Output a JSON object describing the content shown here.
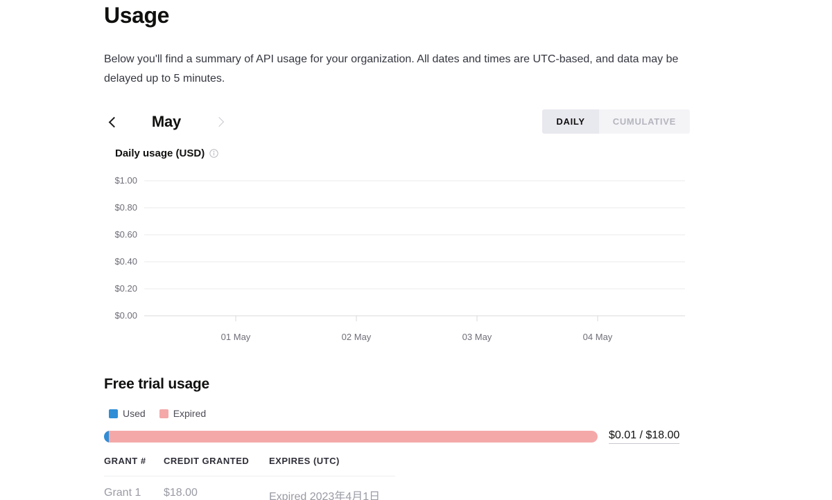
{
  "header": {
    "title": "Usage",
    "description": "Below you'll find a summary of API usage for your organization. All dates and times are UTC-based, and data may be delayed up to 5 minutes."
  },
  "controls": {
    "prev_icon": "chevron-left-icon",
    "next_icon": "chevron-right-icon",
    "month": "May",
    "segments": [
      {
        "label": "DAILY",
        "active": true
      },
      {
        "label": "CUMULATIVE",
        "active": false
      }
    ]
  },
  "chart_section": {
    "title": "Daily usage (USD)",
    "info_icon": "info-circle-icon"
  },
  "chart_data": {
    "type": "bar",
    "title": "Daily usage (USD)",
    "xlabel": "",
    "ylabel": "",
    "categories": [
      "01 May",
      "02 May",
      "03 May",
      "04 May"
    ],
    "values": [
      0,
      0,
      0,
      0
    ],
    "ylim": [
      0,
      1
    ],
    "yticks": [
      "$0.00",
      "$0.20",
      "$0.40",
      "$0.60",
      "$0.80",
      "$1.00"
    ],
    "ytick_values": [
      0,
      0.2,
      0.4,
      0.6,
      0.8,
      1
    ],
    "grid": true,
    "legend": "none",
    "grid_color": "#ebebeb",
    "tick_label_color": "#6e6e78"
  },
  "trial": {
    "title": "Free trial usage",
    "legend": [
      {
        "label": "Used",
        "color": "#2f8ed6"
      },
      {
        "label": "Expired",
        "color": "#f4a8a8"
      }
    ],
    "bar": {
      "used_percent": 0.06,
      "expired_percent": 100,
      "value_text": "$0.01 / $18.00",
      "used_amount": "$0.01",
      "total_amount": "$18.00"
    },
    "table": {
      "columns": [
        "GRANT #",
        "CREDIT GRANTED",
        "EXPIRES (UTC)"
      ],
      "rows": [
        {
          "grant": "Grant 1",
          "credit": "$18.00",
          "expires": "Expired 2023年4月1日"
        }
      ]
    }
  }
}
